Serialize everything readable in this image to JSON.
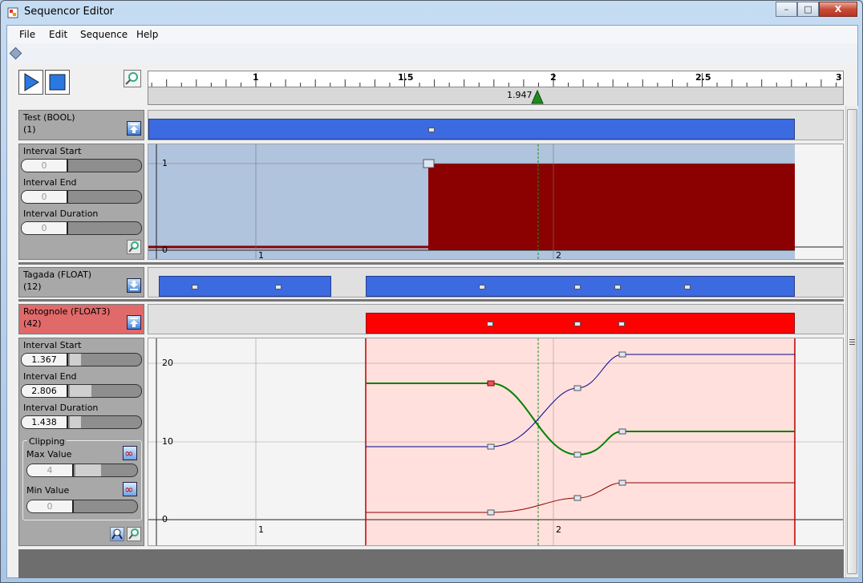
{
  "window": {
    "title": "Sequencor Editor",
    "minimize": "–",
    "maximize": "□",
    "close": "X"
  },
  "menu": {
    "file": "File",
    "edit": "Edit",
    "sequence": "Sequence",
    "help": "Help"
  },
  "ruler": {
    "labels": [
      "1",
      "1.5",
      "2",
      "2.5",
      "3"
    ],
    "cursor_value": "1.947"
  },
  "tracks": {
    "test": {
      "name": "Test (BOOL)",
      "count": "(1)"
    },
    "tagada": {
      "name": "Tagada (FLOAT)",
      "count": "(12)"
    },
    "rotognole": {
      "name": "Rotognole (FLOAT3)",
      "count": "(42)"
    }
  },
  "test_props": {
    "start_label": "Interval Start",
    "start_value": "0",
    "end_label": "Interval End",
    "end_value": "0",
    "duration_label": "Interval Duration",
    "duration_value": "0"
  },
  "rot_props": {
    "start_label": "Interval Start",
    "start_value": "1.367",
    "end_label": "Interval End",
    "end_value": "2.806",
    "duration_label": "Interval Duration",
    "duration_value": "1.438",
    "clipping_label": "Clipping",
    "max_label": "Max Value",
    "max_value": "4",
    "min_label": "Min Value",
    "min_value": "0"
  },
  "graph1": {
    "y_labels": [
      "1",
      "0"
    ],
    "x_labels": [
      "1",
      "2"
    ]
  },
  "graph2": {
    "y_labels": [
      "20",
      "10",
      "0"
    ],
    "x_labels": [
      "1",
      "2"
    ]
  },
  "colors": {
    "accent_blue": "#3c6ae0",
    "bool_fill": "#8b0000",
    "float3_seg": "#ff0000",
    "series_green": "#008000",
    "series_blue": "#00008b",
    "series_red": "#8b0000"
  }
}
